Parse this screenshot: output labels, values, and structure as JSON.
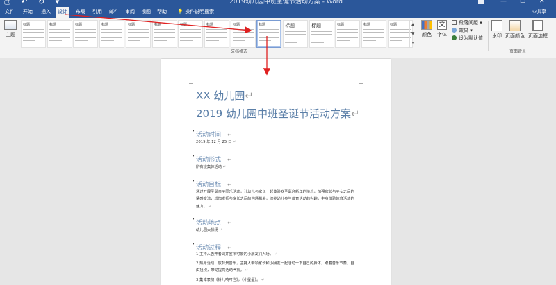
{
  "titlebar": {
    "quick_access": "⎙ ↶ ↻ ▾",
    "doc_title": "2019幼儿园中班圣诞节活动方案 - Word",
    "minimize": "—",
    "maximize": "☐",
    "close": "✕"
  },
  "tabs": [
    "文件",
    "开始",
    "插入",
    "设计",
    "布局",
    "引用",
    "邮件",
    "审阅",
    "视图",
    "帮助"
  ],
  "active_tab": "设计",
  "tell_me": "操作说明搜索",
  "share": "共享",
  "ribbon": {
    "theme_label": "主题",
    "gallery": [
      {
        "title": "标题",
        "big": false
      },
      {
        "title": "标题",
        "big": false
      },
      {
        "title": "标题",
        "big": false
      },
      {
        "title": "标题",
        "big": false
      },
      {
        "title": "标题",
        "big": false
      },
      {
        "title": "标题",
        "big": false
      },
      {
        "title": "标题",
        "big": false
      },
      {
        "title": "标题",
        "big": false
      },
      {
        "title": "标题",
        "big": false
      },
      {
        "title": "标题",
        "big": false
      },
      {
        "title": "标题",
        "big": true
      },
      {
        "title": "标题",
        "big": true
      },
      {
        "title": "标题",
        "big": false
      },
      {
        "title": "标题",
        "big": false
      },
      {
        "title": "标题",
        "big": false
      }
    ],
    "selected_index": 9,
    "doc_format_label": "文档格式",
    "colors_label": "颜色",
    "fonts_label": "字体",
    "fonts_glyph": "文",
    "paragraph_spacing": "段落间距",
    "effects": "效果",
    "set_default": "设为默认值",
    "watermark": "水印",
    "page_color": "页面颜色",
    "page_borders": "页面边框",
    "page_bg_label": "页面背景"
  },
  "document": {
    "title1": "XX 幼儿园",
    "title2": "2019 幼儿园中班圣诞节活动方案",
    "para_mark": "↵",
    "sections": [
      {
        "heading": "活动时间",
        "body": "2019 年 12 月 25 日"
      },
      {
        "heading": "活动形式",
        "body": "所有班集体活动"
      },
      {
        "heading": "活动目标",
        "body": "通过开展圣诞亲子同乐活动，让幼儿与家长一起体验欢圣诞迎新年的快乐，加强家长与子女之间的情感交流，增加老师与家长之间的沟通机会，培养幼儿参与体育活动的兴趣，丰身体验体育活动的魅力。"
      },
      {
        "heading": "活动地点",
        "body": "幼儿园大操场"
      },
      {
        "heading": "活动过程",
        "body": ""
      }
    ],
    "process_items": [
      "1.主持人告开者词并宣布可爱的小朋友们入场。",
      "2.热身活动：放背景音乐，主持人带领家长和小朋友一起活动一下自己的身体，跟着音乐节奏，自由扭秧，带动提高活动气氛。",
      "3.集体表演《铃儿响叮当》，《小星星》。"
    ]
  },
  "colors": {
    "brand": "#2b579a",
    "ribbon_bg": "#f3f3f3",
    "heading": "#5b7fa8",
    "arrow": "#e02020"
  }
}
